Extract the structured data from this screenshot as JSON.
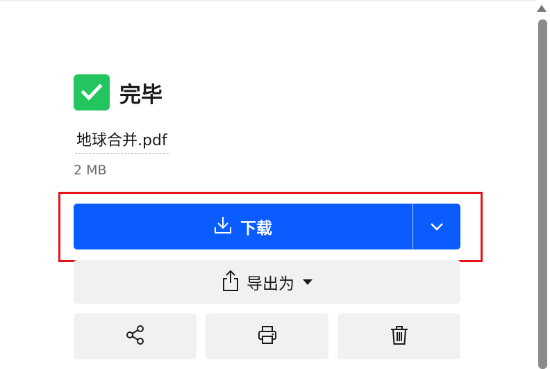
{
  "status": {
    "label": "完毕",
    "icon": "check-icon"
  },
  "file": {
    "name": "地球合并.pdf",
    "size": "2 MB"
  },
  "download": {
    "label": "下载",
    "icon": "download-icon",
    "menu_icon": "chevron-down-icon"
  },
  "export": {
    "label": "导出为",
    "icon": "share-upload-icon"
  },
  "actions": [
    {
      "name": "share",
      "icon": "share-icon"
    },
    {
      "name": "print",
      "icon": "printer-icon"
    },
    {
      "name": "delete",
      "icon": "trash-icon"
    }
  ],
  "colors": {
    "primary": "#0a5cff",
    "success": "#22c55e",
    "highlight": "#e3151b",
    "secondary_bg": "#f1f1f1"
  }
}
